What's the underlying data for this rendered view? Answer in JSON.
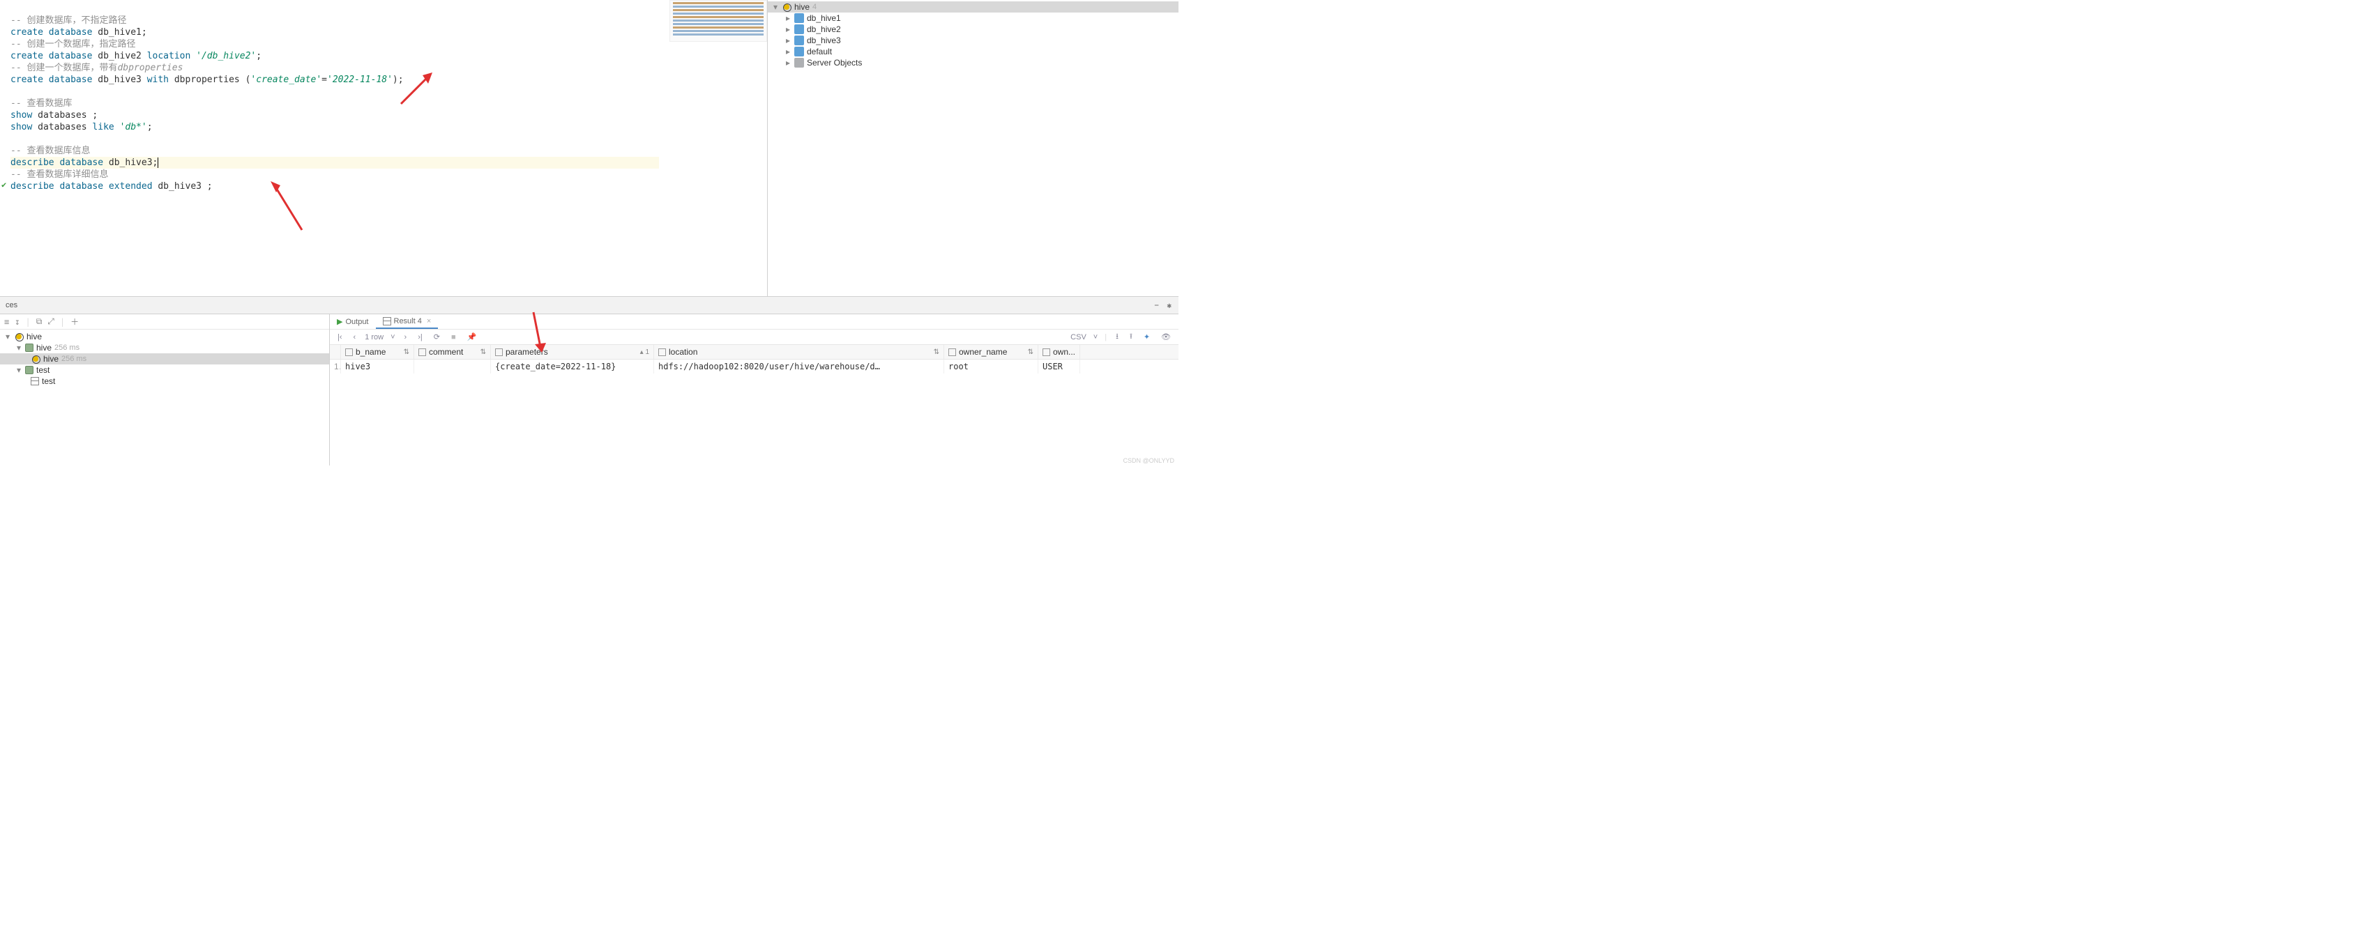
{
  "editor": {
    "comment1": "-- 创建数据库，不指定路径",
    "l1_kw_create": "create",
    "l1_kw_database": "database",
    "l1_id": "db_hive1",
    "comment2": "-- 创建一个数据库，指定路径",
    "l2_id": "db_hive2",
    "l2_kw_location": "location",
    "l2_str": "'/db_hive2'",
    "comment3_pre": "-- 创建一个数据库，带有",
    "comment3_it": "dbproperties",
    "l3_id": "db_hive3",
    "l3_kw_with": "with",
    "l3_word_dbprop": "dbproperties",
    "l3_str_k": "'create_date'",
    "l3_eq": "=",
    "l3_str_v": "'2022-11-18'",
    "comment4": "-- 查看数据库",
    "l4_kw_show": "show",
    "l4_word_db": "databases",
    "l5_kw_like": "like",
    "l5_str": "'db*'",
    "comment5": "-- 查看数据库信息",
    "l6_kw_desc": "describe",
    "l6_kw_db": "database",
    "l6_id": "db_hive3",
    "comment6": "-- 查看数据库详细信息",
    "l7_kw_ext": "extended",
    "l7_id": "db_hive3",
    "status_count": "1"
  },
  "dbtree": {
    "root": "hive",
    "root_count": "4",
    "items": [
      "db_hive1",
      "db_hive2",
      "db_hive3",
      "default",
      "Server Objects"
    ]
  },
  "services": {
    "label": "ces"
  },
  "bl": {
    "root": "hive",
    "ds": "hive",
    "ds_time": "256 ms",
    "ds2": "hive",
    "ds2_time": "256 ms",
    "test": "test",
    "test_child": "test"
  },
  "br": {
    "tab_output": "Output",
    "tab_result": "Result 4",
    "rows_label": "1 row",
    "csv": "CSV",
    "head_rownum": "1",
    "cols": {
      "c1": "b_name",
      "c2": "comment",
      "c3": "parameters",
      "c4": "location",
      "c5": "owner_name",
      "c6": "own..."
    },
    "row1": {
      "rn": "1",
      "b_name": "hive3",
      "comment": "",
      "parameters": "{create_date=2022-11-18}",
      "location": "hdfs://hadoop102:8020/user/hive/warehouse/d…",
      "owner_name": "root",
      "own": "USER"
    }
  },
  "watermark": "CSDN @ONLYYD"
}
